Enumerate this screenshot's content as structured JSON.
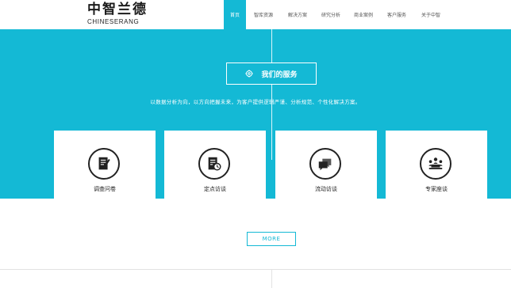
{
  "logo": {
    "cn": "中智兰德",
    "en": "CHINESERANG"
  },
  "nav": [
    {
      "label": "首页",
      "active": true
    },
    {
      "label": "智库资源",
      "active": false
    },
    {
      "label": "解决方案",
      "active": false
    },
    {
      "label": "研究分析",
      "active": false
    },
    {
      "label": "商业案例",
      "active": false
    },
    {
      "label": "客户服务",
      "active": false
    },
    {
      "label": "关于中智",
      "active": false
    }
  ],
  "services": {
    "title": "我们的服务",
    "title_icon": "gear-icon",
    "tagline": "以数据分析为向，以方向把握未来，为客户提供逻辑严谨、分析规范、个性化解决方案。",
    "cards": [
      {
        "label": "调查问卷",
        "icon": "questionnaire-icon"
      },
      {
        "label": "定点访谈",
        "icon": "document-clock-icon"
      },
      {
        "label": "流动访谈",
        "icon": "chat-bubbles-icon"
      },
      {
        "label": "专家座谈",
        "icon": "meeting-icon"
      }
    ]
  },
  "more_label": "MORE",
  "colors": {
    "accent": "#14b9d5",
    "background": "#ffffff",
    "text": "#222222"
  }
}
